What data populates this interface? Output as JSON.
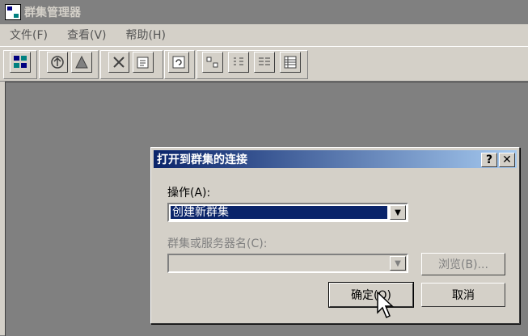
{
  "app": {
    "title": "群集管理器"
  },
  "menu": [
    {
      "label": "文件(F)"
    },
    {
      "label": "查看(V)"
    },
    {
      "label": "帮助(H)"
    }
  ],
  "toolbar": {
    "icons": [
      "cluster-icon",
      "open-connection-icon",
      "warning-icon",
      "delete-icon",
      "properties-icon",
      "refresh-icon",
      "large-icons-view-icon",
      "small-icons-view-icon",
      "list-view-icon",
      "details-view-icon"
    ]
  },
  "dialog": {
    "title": "打开到群集的连接",
    "help_label": "?",
    "close_label": "✕",
    "operation_label": "操作(A):",
    "operation_value": "创建新群集",
    "server_label": "群集或服务器名(C):",
    "server_value": "",
    "browse_label": "浏览(B)...",
    "ok_label": "确定(O)",
    "cancel_label": "取消"
  }
}
